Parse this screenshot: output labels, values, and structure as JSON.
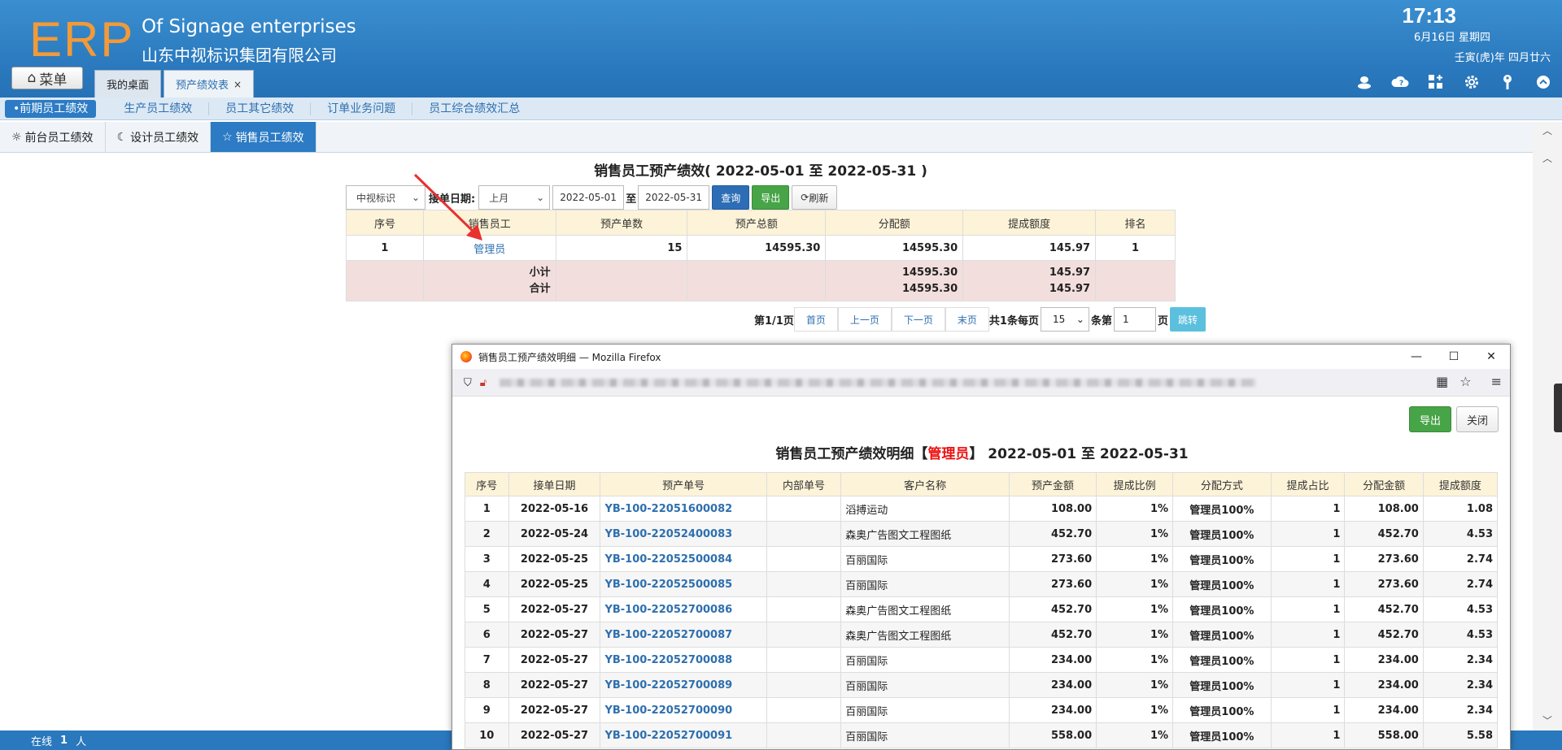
{
  "header": {
    "logo": "ERP",
    "brand_en": "Of Signage enterprises",
    "brand_cn": "山东中视标识集团有限公司",
    "time": "17:13",
    "date": "6月16日 星期四",
    "lunar": "壬寅(虎)年 四月廿六",
    "menu_label": "菜单",
    "tabs": [
      {
        "label": "我的桌面"
      },
      {
        "label": "预产绩效表",
        "close": "×"
      }
    ],
    "icons": [
      "user-icon",
      "cloud-help-icon",
      "grid-add-icon",
      "gear-icon",
      "key-icon",
      "collapse-icon"
    ]
  },
  "subnav": {
    "items": [
      "•前期员工绩效",
      "生产员工绩效",
      "员工其它绩效",
      "订单业务问题",
      "员工综合绩效汇总"
    ]
  },
  "thirdnav": {
    "items": [
      "前台员工绩效",
      "设计员工绩效",
      "销售员工绩效"
    ]
  },
  "report": {
    "title": "销售员工预产绩效( 2022-05-01 至 2022-05-31 )",
    "filter": {
      "company": "中视标识",
      "date_label": "接单日期:",
      "period": "上月",
      "from": "2022-05-01",
      "to_label": "至",
      "to": "2022-05-31",
      "query": "查询",
      "export": "导出",
      "refresh": "刷新"
    },
    "columns": [
      "序号",
      "销售员工",
      "预产单数",
      "预产总额",
      "分配额",
      "提成额度",
      "排名"
    ],
    "rows": [
      {
        "no": "1",
        "employee": "管理员",
        "orders": "15",
        "total": "14595.30",
        "allocated": "14595.30",
        "commission": "145.97",
        "rank": "1"
      }
    ],
    "subtotal_label": "小计",
    "total_label": "合计",
    "subtotal": {
      "allocated": "14595.30",
      "commission": "145.97"
    },
    "total": {
      "allocated": "14595.30",
      "commission": "145.97"
    },
    "pager": {
      "page_info": "第1/1页",
      "first": "首页",
      "prev": "上一页",
      "next": "下一页",
      "last": "末页",
      "count_text": "共1条每页",
      "page_size": "15",
      "goto_label": "条第",
      "goto_value": "1",
      "page_suffix": "页",
      "go": "跳转"
    }
  },
  "statusbar": {
    "online_label": "在线",
    "online_count": "1",
    "unit": "人"
  },
  "popup": {
    "window_title": "销售员工预产绩效明细 — Mozilla Firefox",
    "export": "导出",
    "close": "关闭",
    "title_prefix": "销售员工预产绩效明细【",
    "title_name": "管理员",
    "title_suffix": "】 2022-05-01 至 2022-05-31",
    "columns": [
      "序号",
      "接单日期",
      "预产单号",
      "内部单号",
      "客户名称",
      "预产金额",
      "提成比例",
      "分配方式",
      "提成占比",
      "分配金额",
      "提成额度"
    ],
    "rows": [
      {
        "no": "1",
        "date": "2022-05-16",
        "order": "YB-100-22051600082",
        "inner": "",
        "customer": "滔搏运动",
        "amount": "108.00",
        "ratio": "1%",
        "method": "管理员100%",
        "share": "1",
        "alloc": "108.00",
        "comm": "1.08"
      },
      {
        "no": "2",
        "date": "2022-05-24",
        "order": "YB-100-22052400083",
        "inner": "",
        "customer": "森奥广告图文工程图纸",
        "amount": "452.70",
        "ratio": "1%",
        "method": "管理员100%",
        "share": "1",
        "alloc": "452.70",
        "comm": "4.53"
      },
      {
        "no": "3",
        "date": "2022-05-25",
        "order": "YB-100-22052500084",
        "inner": "",
        "customer": "百丽国际",
        "amount": "273.60",
        "ratio": "1%",
        "method": "管理员100%",
        "share": "1",
        "alloc": "273.60",
        "comm": "2.74"
      },
      {
        "no": "4",
        "date": "2022-05-25",
        "order": "YB-100-22052500085",
        "inner": "",
        "customer": "百丽国际",
        "amount": "273.60",
        "ratio": "1%",
        "method": "管理员100%",
        "share": "1",
        "alloc": "273.60",
        "comm": "2.74"
      },
      {
        "no": "5",
        "date": "2022-05-27",
        "order": "YB-100-22052700086",
        "inner": "",
        "customer": "森奥广告图文工程图纸",
        "amount": "452.70",
        "ratio": "1%",
        "method": "管理员100%",
        "share": "1",
        "alloc": "452.70",
        "comm": "4.53"
      },
      {
        "no": "6",
        "date": "2022-05-27",
        "order": "YB-100-22052700087",
        "inner": "",
        "customer": "森奥广告图文工程图纸",
        "amount": "452.70",
        "ratio": "1%",
        "method": "管理员100%",
        "share": "1",
        "alloc": "452.70",
        "comm": "4.53"
      },
      {
        "no": "7",
        "date": "2022-05-27",
        "order": "YB-100-22052700088",
        "inner": "",
        "customer": "百丽国际",
        "amount": "234.00",
        "ratio": "1%",
        "method": "管理员100%",
        "share": "1",
        "alloc": "234.00",
        "comm": "2.34"
      },
      {
        "no": "8",
        "date": "2022-05-27",
        "order": "YB-100-22052700089",
        "inner": "",
        "customer": "百丽国际",
        "amount": "234.00",
        "ratio": "1%",
        "method": "管理员100%",
        "share": "1",
        "alloc": "234.00",
        "comm": "2.34"
      },
      {
        "no": "9",
        "date": "2022-05-27",
        "order": "YB-100-22052700090",
        "inner": "",
        "customer": "百丽国际",
        "amount": "234.00",
        "ratio": "1%",
        "method": "管理员100%",
        "share": "1",
        "alloc": "234.00",
        "comm": "2.34"
      },
      {
        "no": "10",
        "date": "2022-05-27",
        "order": "YB-100-22052700091",
        "inner": "",
        "customer": "百丽国际",
        "amount": "558.00",
        "ratio": "1%",
        "method": "管理员100%",
        "share": "1",
        "alloc": "558.00",
        "comm": "5.58"
      }
    ]
  },
  "colors": {
    "header_blue": "#2a78bd",
    "logo_orange": "#f29a38",
    "table_header": "#fdf3d8",
    "sum_row": "#f3dede",
    "link_blue": "#2e6fae",
    "highlight_red": "#e11111",
    "arrow_red": "#e8312f"
  }
}
